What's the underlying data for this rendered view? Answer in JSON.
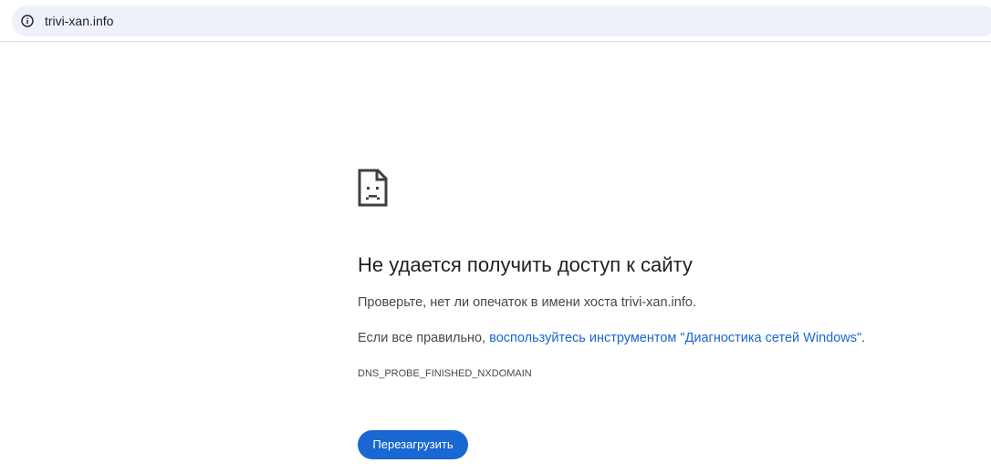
{
  "address_bar": {
    "url": "trivi-xan.info",
    "icon": "info-icon"
  },
  "error_page": {
    "icon": "sad-page-icon",
    "heading": "Не удается получить доступ к сайту",
    "check_text": "Проверьте, нет ли опечаток в имени хоста trivi-xan.info.",
    "suggestion_prefix": "Если все правильно, ",
    "suggestion_link": "воспользуйтесь инструментом \"Диагностика сетей Windows\"",
    "suggestion_suffix": ".",
    "error_code": "DNS_PROBE_FINISHED_NXDOMAIN",
    "reload_button": "Перезагрузить"
  },
  "colors": {
    "accent": "#1967d2",
    "omnibox_bg": "#eef1f9",
    "text_primary": "#202124",
    "text_secondary": "#474747"
  }
}
